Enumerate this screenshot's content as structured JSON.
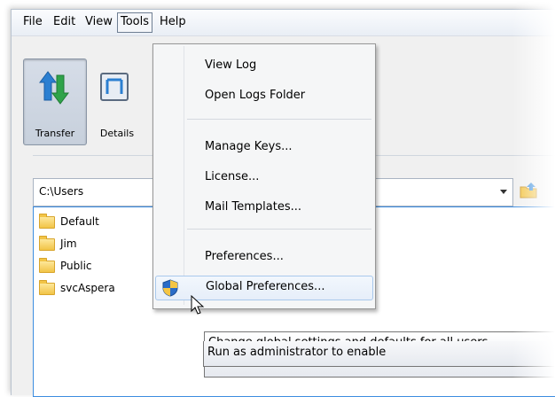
{
  "menubar": {
    "items": [
      "File",
      "Edit",
      "View",
      "Tools",
      "Help"
    ]
  },
  "toolbar": {
    "transfer_label": "Transfer",
    "details_label": "Details"
  },
  "path": {
    "value": "C:\\Users"
  },
  "files": [
    "Default",
    "Jim",
    "Public",
    "svcAspera"
  ],
  "tools_menu": {
    "view_log": "View Log",
    "open_logs_folder": "Open Logs Folder",
    "manage_keys": "Manage Keys...",
    "license": "License...",
    "mail_templates": "Mail Templates...",
    "preferences": "Preferences...",
    "global_preferences": "Global Preferences..."
  },
  "tooltip": {
    "line1": "Change global settings and defaults for all users",
    "line2": "Run as administrator to enable"
  },
  "colors": {
    "menu_hover_border": "#a8c8ec",
    "tooltip_bg": "#ffffff",
    "list_focus_border": "#3d8de0"
  }
}
